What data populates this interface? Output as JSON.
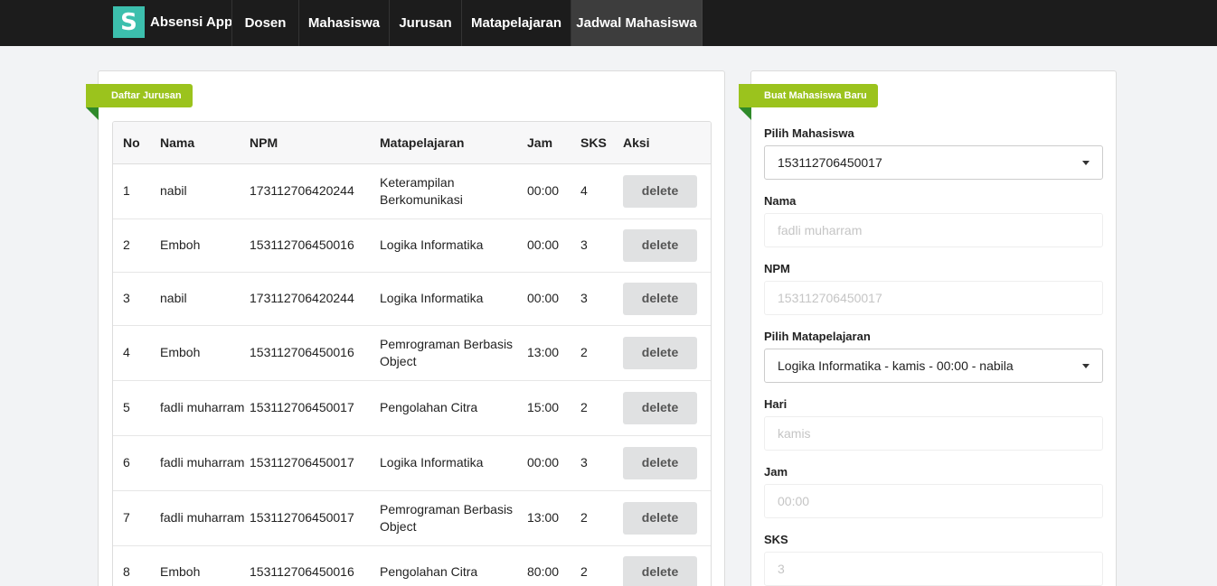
{
  "app": {
    "logo_letter": "S",
    "name": "Absensi App"
  },
  "nav": [
    {
      "label": "Dosen",
      "active": false,
      "width": 74
    },
    {
      "label": "Mahasiswa",
      "active": false,
      "width": 100
    },
    {
      "label": "Jurusan",
      "active": false,
      "width": 80
    },
    {
      "label": "Matapelajaran",
      "active": false,
      "width": 121
    },
    {
      "label": "Jadwal Mahasiswa",
      "active": true,
      "width": 146
    }
  ],
  "list_panel": {
    "ribbon": "Daftar Jurusan",
    "columns": [
      "No",
      "Nama",
      "NPM",
      "Matapelajaran",
      "Jam",
      "SKS",
      "Aksi"
    ],
    "delete_label": "delete",
    "rows": [
      {
        "no": "1",
        "nama": "nabil",
        "npm": "173112706420244",
        "matapelajaran": "Keterampilan Berkomunikasi",
        "jam": "00:00",
        "sks": "4"
      },
      {
        "no": "2",
        "nama": "Emboh",
        "npm": "153112706450016",
        "matapelajaran": "Logika Informatika",
        "jam": "00:00",
        "sks": "3"
      },
      {
        "no": "3",
        "nama": "nabil",
        "npm": "173112706420244",
        "matapelajaran": "Logika Informatika",
        "jam": "00:00",
        "sks": "3"
      },
      {
        "no": "4",
        "nama": "Emboh",
        "npm": "153112706450016",
        "matapelajaran": "Pemrograman Berbasis Object",
        "jam": "13:00",
        "sks": "2"
      },
      {
        "no": "5",
        "nama": "fadli muharram",
        "npm": "153112706450017",
        "matapelajaran": "Pengolahan Citra",
        "jam": "15:00",
        "sks": "2"
      },
      {
        "no": "6",
        "nama": "fadli muharram",
        "npm": "153112706450017",
        "matapelajaran": "Logika Informatika",
        "jam": "00:00",
        "sks": "3"
      },
      {
        "no": "7",
        "nama": "fadli muharram",
        "npm": "153112706450017",
        "matapelajaran": "Pemrograman Berbasis Object",
        "jam": "13:00",
        "sks": "2"
      },
      {
        "no": "8",
        "nama": "Emboh",
        "npm": "153112706450016",
        "matapelajaran": "Pengolahan Citra",
        "jam": "80:00",
        "sks": "2"
      }
    ]
  },
  "form_panel": {
    "ribbon": "Buat Mahasiswa Baru",
    "pilih_mahasiswa": {
      "label": "Pilih Mahasiswa",
      "value": "153112706450017"
    },
    "nama": {
      "label": "Nama",
      "placeholder": "fadli muharram"
    },
    "npm": {
      "label": "NPM",
      "placeholder": "153112706450017"
    },
    "pilih_matapelajaran": {
      "label": "Pilih Matapelajaran",
      "value": "Logika Informatika - kamis - 00:00 - nabila"
    },
    "hari": {
      "label": "Hari",
      "placeholder": "kamis"
    },
    "jam": {
      "label": "Jam",
      "placeholder": "00:00"
    },
    "sks": {
      "label": "SKS",
      "placeholder": "3"
    }
  }
}
